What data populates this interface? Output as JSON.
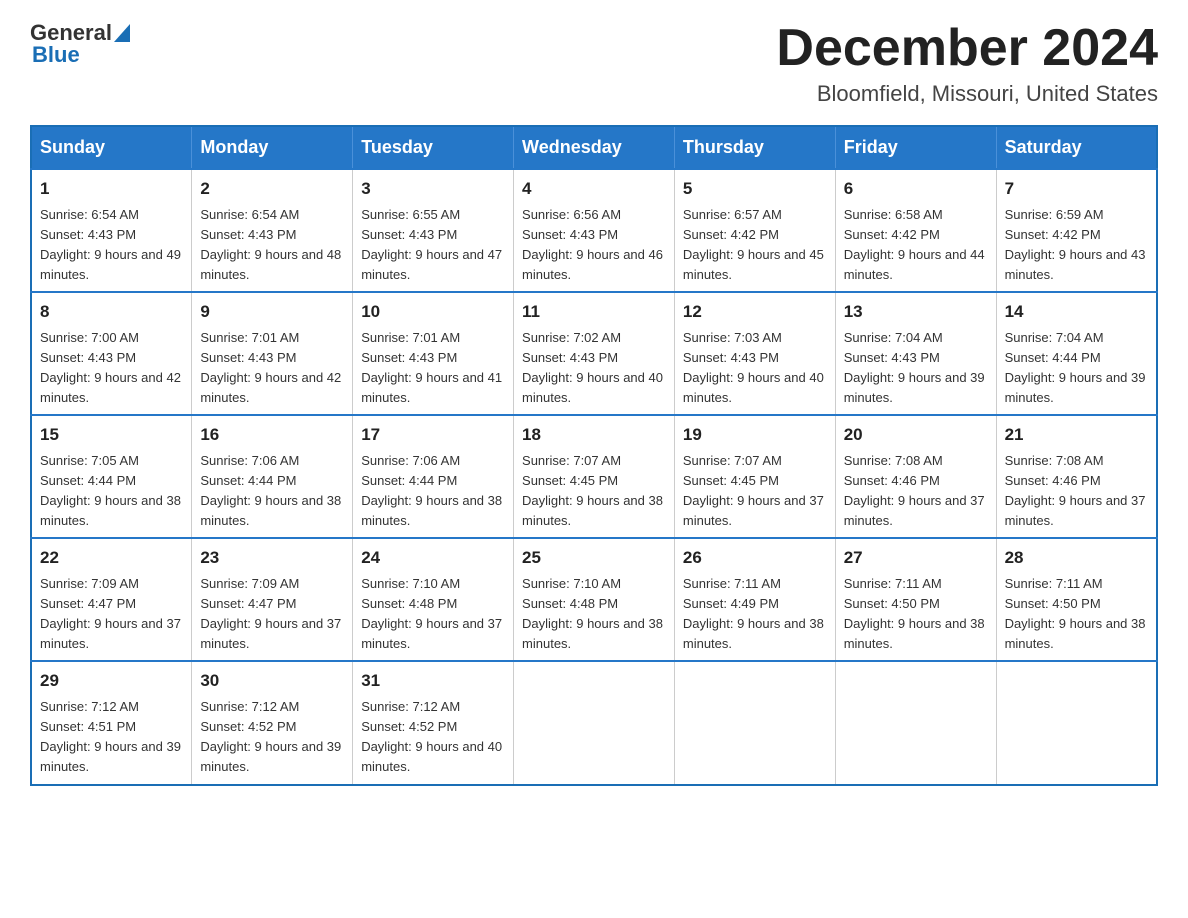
{
  "header": {
    "logo_general": "General",
    "logo_blue": "Blue",
    "title": "December 2024",
    "subtitle": "Bloomfield, Missouri, United States"
  },
  "days_of_week": [
    "Sunday",
    "Monday",
    "Tuesday",
    "Wednesday",
    "Thursday",
    "Friday",
    "Saturday"
  ],
  "weeks": [
    [
      {
        "day": 1,
        "sunrise": "6:54 AM",
        "sunset": "4:43 PM",
        "daylight": "9 hours and 49 minutes."
      },
      {
        "day": 2,
        "sunrise": "6:54 AM",
        "sunset": "4:43 PM",
        "daylight": "9 hours and 48 minutes."
      },
      {
        "day": 3,
        "sunrise": "6:55 AM",
        "sunset": "4:43 PM",
        "daylight": "9 hours and 47 minutes."
      },
      {
        "day": 4,
        "sunrise": "6:56 AM",
        "sunset": "4:43 PM",
        "daylight": "9 hours and 46 minutes."
      },
      {
        "day": 5,
        "sunrise": "6:57 AM",
        "sunset": "4:42 PM",
        "daylight": "9 hours and 45 minutes."
      },
      {
        "day": 6,
        "sunrise": "6:58 AM",
        "sunset": "4:42 PM",
        "daylight": "9 hours and 44 minutes."
      },
      {
        "day": 7,
        "sunrise": "6:59 AM",
        "sunset": "4:42 PM",
        "daylight": "9 hours and 43 minutes."
      }
    ],
    [
      {
        "day": 8,
        "sunrise": "7:00 AM",
        "sunset": "4:43 PM",
        "daylight": "9 hours and 42 minutes."
      },
      {
        "day": 9,
        "sunrise": "7:01 AM",
        "sunset": "4:43 PM",
        "daylight": "9 hours and 42 minutes."
      },
      {
        "day": 10,
        "sunrise": "7:01 AM",
        "sunset": "4:43 PM",
        "daylight": "9 hours and 41 minutes."
      },
      {
        "day": 11,
        "sunrise": "7:02 AM",
        "sunset": "4:43 PM",
        "daylight": "9 hours and 40 minutes."
      },
      {
        "day": 12,
        "sunrise": "7:03 AM",
        "sunset": "4:43 PM",
        "daylight": "9 hours and 40 minutes."
      },
      {
        "day": 13,
        "sunrise": "7:04 AM",
        "sunset": "4:43 PM",
        "daylight": "9 hours and 39 minutes."
      },
      {
        "day": 14,
        "sunrise": "7:04 AM",
        "sunset": "4:44 PM",
        "daylight": "9 hours and 39 minutes."
      }
    ],
    [
      {
        "day": 15,
        "sunrise": "7:05 AM",
        "sunset": "4:44 PM",
        "daylight": "9 hours and 38 minutes."
      },
      {
        "day": 16,
        "sunrise": "7:06 AM",
        "sunset": "4:44 PM",
        "daylight": "9 hours and 38 minutes."
      },
      {
        "day": 17,
        "sunrise": "7:06 AM",
        "sunset": "4:44 PM",
        "daylight": "9 hours and 38 minutes."
      },
      {
        "day": 18,
        "sunrise": "7:07 AM",
        "sunset": "4:45 PM",
        "daylight": "9 hours and 38 minutes."
      },
      {
        "day": 19,
        "sunrise": "7:07 AM",
        "sunset": "4:45 PM",
        "daylight": "9 hours and 37 minutes."
      },
      {
        "day": 20,
        "sunrise": "7:08 AM",
        "sunset": "4:46 PM",
        "daylight": "9 hours and 37 minutes."
      },
      {
        "day": 21,
        "sunrise": "7:08 AM",
        "sunset": "4:46 PM",
        "daylight": "9 hours and 37 minutes."
      }
    ],
    [
      {
        "day": 22,
        "sunrise": "7:09 AM",
        "sunset": "4:47 PM",
        "daylight": "9 hours and 37 minutes."
      },
      {
        "day": 23,
        "sunrise": "7:09 AM",
        "sunset": "4:47 PM",
        "daylight": "9 hours and 37 minutes."
      },
      {
        "day": 24,
        "sunrise": "7:10 AM",
        "sunset": "4:48 PM",
        "daylight": "9 hours and 37 minutes."
      },
      {
        "day": 25,
        "sunrise": "7:10 AM",
        "sunset": "4:48 PM",
        "daylight": "9 hours and 38 minutes."
      },
      {
        "day": 26,
        "sunrise": "7:11 AM",
        "sunset": "4:49 PM",
        "daylight": "9 hours and 38 minutes."
      },
      {
        "day": 27,
        "sunrise": "7:11 AM",
        "sunset": "4:50 PM",
        "daylight": "9 hours and 38 minutes."
      },
      {
        "day": 28,
        "sunrise": "7:11 AM",
        "sunset": "4:50 PM",
        "daylight": "9 hours and 38 minutes."
      }
    ],
    [
      {
        "day": 29,
        "sunrise": "7:12 AM",
        "sunset": "4:51 PM",
        "daylight": "9 hours and 39 minutes."
      },
      {
        "day": 30,
        "sunrise": "7:12 AM",
        "sunset": "4:52 PM",
        "daylight": "9 hours and 39 minutes."
      },
      {
        "day": 31,
        "sunrise": "7:12 AM",
        "sunset": "4:52 PM",
        "daylight": "9 hours and 40 minutes."
      },
      null,
      null,
      null,
      null
    ]
  ]
}
